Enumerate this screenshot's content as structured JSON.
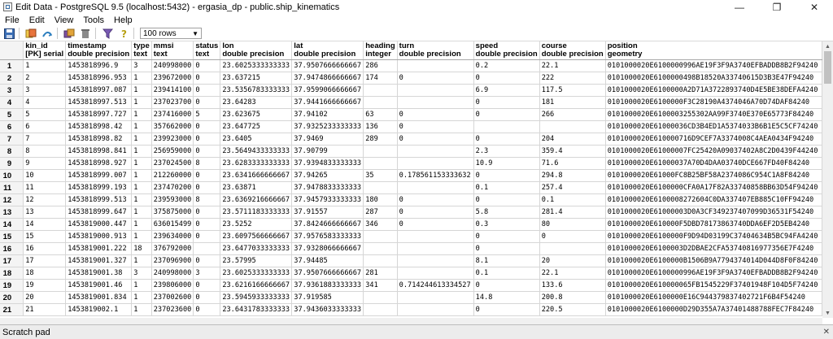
{
  "window": {
    "title": "Edit Data - PostgreSQL 9.5 (localhost:5432) - ergasia_dp - public.ship_kinematics"
  },
  "menu": [
    "File",
    "Edit",
    "View",
    "Tools",
    "Help"
  ],
  "toolbar": {
    "rows_limit": "100 rows",
    "icons": [
      "save-icon",
      "copy-icon",
      "paste-icon",
      "undo-icon",
      "delete-icon",
      "filter-icon",
      "help-icon"
    ]
  },
  "grid": {
    "columns": [
      {
        "name": "kin_id",
        "type": "[PK] serial"
      },
      {
        "name": "timestamp",
        "type": "double precision"
      },
      {
        "name": "type",
        "type": "text"
      },
      {
        "name": "mmsi",
        "type": "text"
      },
      {
        "name": "status",
        "type": "text"
      },
      {
        "name": "lon",
        "type": "double precision"
      },
      {
        "name": "lat",
        "type": "double precision"
      },
      {
        "name": "heading",
        "type": "integer"
      },
      {
        "name": "turn",
        "type": "double precision"
      },
      {
        "name": "speed",
        "type": "double precision"
      },
      {
        "name": "course",
        "type": "double precision"
      },
      {
        "name": "position",
        "type": "geometry"
      }
    ],
    "rows": [
      [
        "1",
        "1",
        "1453818996.9",
        "3",
        "240998000",
        "0",
        "23.6025333333333",
        "37.9507666666667",
        "286",
        "",
        "0.2",
        "22.1",
        "0101000020E6100000996AE19F3F9A3740EFBADDB8B2F94240"
      ],
      [
        "2",
        "2",
        "1453818996.953",
        "1",
        "239672000",
        "0",
        "23.637215",
        "37.9474866666667",
        "174",
        "0",
        "0",
        "222",
        "0101000020E6100000498B18520A33740615D3B3E47F94240"
      ],
      [
        "3",
        "3",
        "1453818997.087",
        "1",
        "239414100",
        "0",
        "23.5356783333333",
        "37.9599066666667",
        "",
        "",
        "6.9",
        "117.5",
        "0101000020E6100000A2D71A3722893740D4E5BE38DEFA4240"
      ],
      [
        "4",
        "4",
        "1453818997.513",
        "1",
        "237023700",
        "0",
        "23.64283",
        "37.9441666666667",
        "",
        "",
        "0",
        "181",
        "0101000020E6100000F3C28190A4374046A70D74DAF84240"
      ],
      [
        "5",
        "5",
        "1453818997.727",
        "1",
        "237416000",
        "5",
        "23.623675",
        "37.94102",
        "63",
        "0",
        "0",
        "266",
        "0101000020E6100003255302AA99F3740E370E65773F84240"
      ],
      [
        "6",
        "6",
        "1453818998.42",
        "1",
        "357662000",
        "0",
        "23.647725",
        "37.9325233333333",
        "136",
        "0",
        "",
        "",
        "0101000020E61000036CD3B4ED1A5374033B6B1E5C5CF74240"
      ],
      [
        "7",
        "7",
        "1453818998.82",
        "1",
        "239923000",
        "0",
        "23.6405",
        "37.9469",
        "289",
        "0",
        "0",
        "204",
        "0101000020E610000716D9CEF7A3374008C4AEA0434F94240"
      ],
      [
        "8",
        "8",
        "1453818998.841",
        "1",
        "256959000",
        "0",
        "23.5649433333333",
        "37.90799",
        "",
        "",
        "2.3",
        "359.4",
        "0101000020E61000007FC25420A09037402A8C2D0439F44240"
      ],
      [
        "9",
        "9",
        "1453818998.927",
        "1",
        "237024500",
        "8",
        "23.6283333333333",
        "37.9394833333333",
        "",
        "",
        "10.9",
        "71.6",
        "0101000020E61000037A70D4DAA03740DCE667FD40F84240"
      ],
      [
        "10",
        "10",
        "1453818999.007",
        "1",
        "212260000",
        "0",
        "23.6341666666667",
        "37.94265",
        "35",
        "0.178561153333632",
        "0",
        "294.8",
        "0101000020E61000FC8B25BF58A2374086C954C1A8F84240"
      ],
      [
        "11",
        "11",
        "1453818999.193",
        "1",
        "237470200",
        "0",
        "23.63871",
        "37.9478833333333",
        "",
        "",
        "0.1",
        "257.4",
        "0101000020E6100000CFA0A17F82A33740858BB63D54F94240"
      ],
      [
        "12",
        "12",
        "1453818999.513",
        "1",
        "239593000",
        "8",
        "23.6369216666667",
        "37.9457933333333",
        "180",
        "0",
        "0",
        "0.1",
        "0101000020E6100008272604C0DA337407EB885C10FF94240"
      ],
      [
        "13",
        "13",
        "1453818999.647",
        "1",
        "375875000",
        "0",
        "23.5711183333333",
        "37.91557",
        "287",
        "0",
        "5.8",
        "281.4",
        "0101000020E61000003D0A3CF349237407099D36531F54240"
      ],
      [
        "14",
        "14",
        "1453819000.447",
        "1",
        "636015499",
        "0",
        "23.5252",
        "37.8424666666667",
        "346",
        "0",
        "0.3",
        "80",
        "0101000020E610000F5DBD78173863740DDA6EF2D5EB4240"
      ],
      [
        "15",
        "15",
        "1453819000.913",
        "1",
        "239634000",
        "0",
        "23.6097566666667",
        "37.9576583333333",
        "",
        "",
        "0",
        "0",
        "0101000020E6100000F9D94D03199C37404634B5BC94FA4240"
      ],
      [
        "16",
        "16",
        "1453819001.222",
        "18",
        "376792000",
        "",
        "23.6477033333333",
        "37.9328066666667",
        "",
        "",
        "0",
        "",
        "0101000020E6100003D2DBAE2CFA53740816977356E7F4240"
      ],
      [
        "17",
        "17",
        "1453819001.327",
        "1",
        "237096900",
        "0",
        "23.57995",
        "37.94485",
        "",
        "",
        "8.1",
        "20",
        "0101000020E6100000B1506B9A7794374014D044D8F0F84240"
      ],
      [
        "18",
        "18",
        "1453819001.38",
        "3",
        "240998000",
        "3",
        "23.6025333333333",
        "37.9507666666667",
        "281",
        "",
        "0.1",
        "22.1",
        "0101000020E6100000996AE19F3F9A3740EFBADDB8B2F94240"
      ],
      [
        "19",
        "19",
        "1453819001.46",
        "1",
        "239806000",
        "0",
        "23.6216166666667",
        "37.9361883333333",
        "341",
        "0.714244613334527",
        "0",
        "133.6",
        "0101000020E610000065FB1545229F37401948F104D5F74240"
      ],
      [
        "20",
        "20",
        "1453819001.834",
        "1",
        "237002600",
        "0",
        "23.5945933333333",
        "37.919585",
        "",
        "",
        "14.8",
        "200.8",
        "0101000020E6100000E16C944379837402721F6B4F54240"
      ],
      [
        "21",
        "21",
        "1453819002.1",
        "1",
        "237023600",
        "0",
        "23.6431783333333",
        "37.9436033333333",
        "",
        "",
        "0",
        "220.5",
        "0101000020E6100000D29D355A7A37401488788FEC7F84240"
      ]
    ]
  },
  "footer": {
    "scratch_pad_label": "Scratch pad"
  }
}
